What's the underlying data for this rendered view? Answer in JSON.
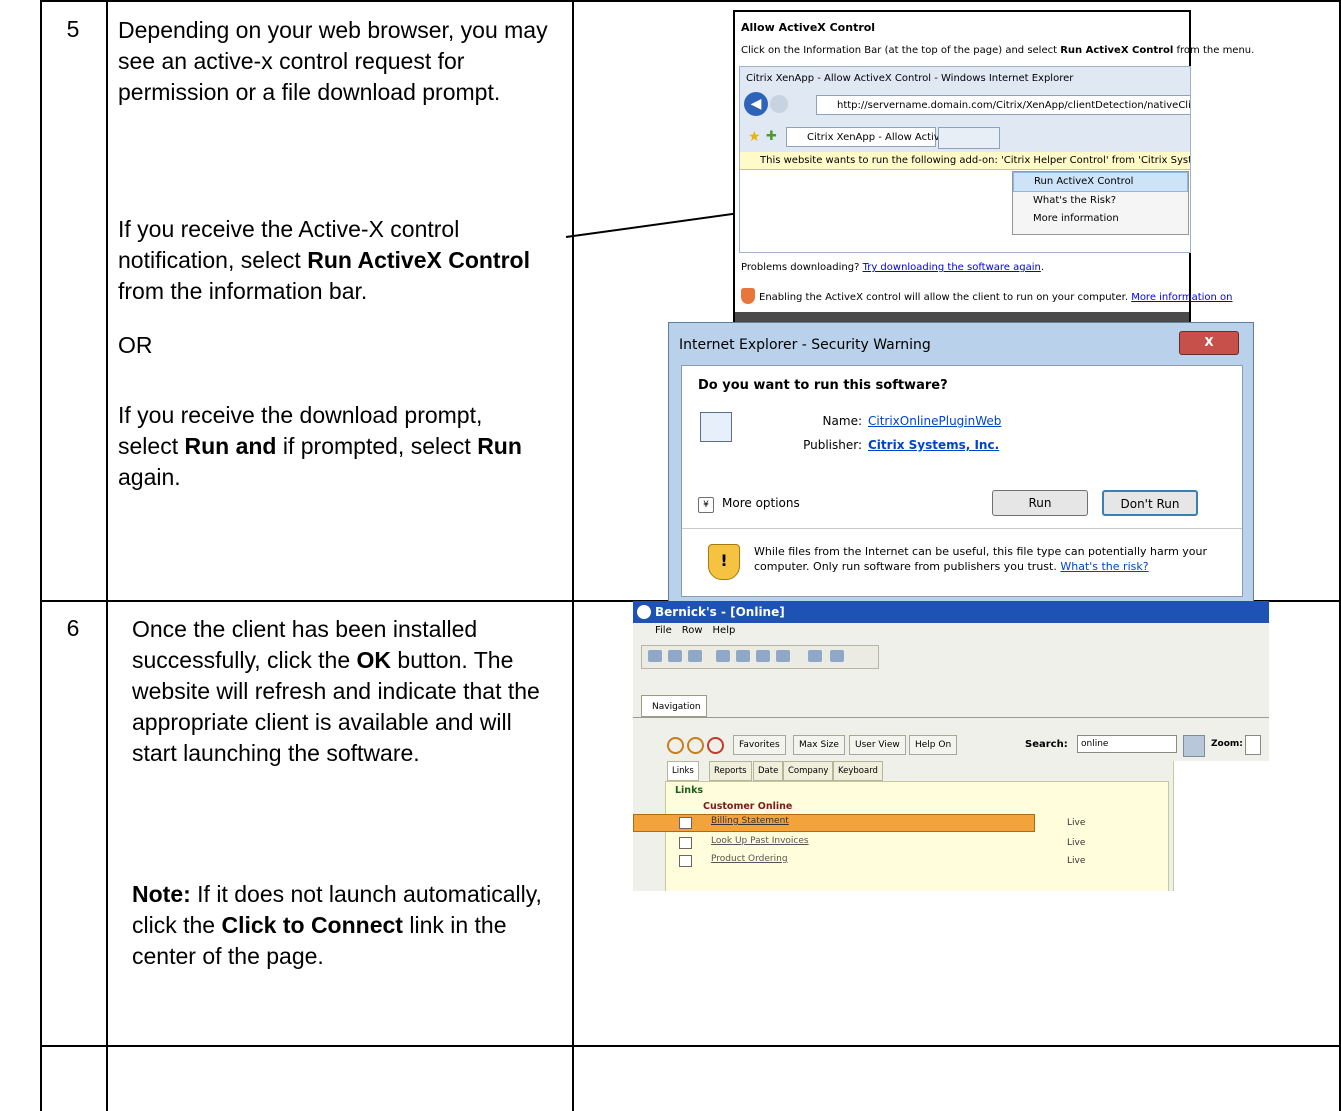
{
  "table": {
    "rows": [
      {
        "step": "5",
        "paragraphs": {
          "p1": "Depending on your web browser, you may see an active-x control request for permission or a file download prompt.",
          "p2_pre": "If you receive the Active-X control notification, select ",
          "p2_bold": "Run ActiveX Control",
          "p2_post": " from the information bar.",
          "p3": "OR",
          "p4_pre": "If you receive the download prompt, select ",
          "p4_bold1": "Run and",
          "p4_mid": " if prompted, select ",
          "p4_bold2": "Run",
          "p4_post": " again."
        }
      },
      {
        "step": "6",
        "paragraphs": {
          "p1_pre": "Once the client has been installed successfully, click the ",
          "p1_bold": "OK",
          "p1_post": " button.  The website will refresh and indicate that the appropriate client is available and will start launching the software.",
          "p2_bold": "Note:",
          "p2_mid": "  If it does not launch automatically, click the ",
          "p2_bold2": "Click to Connect",
          "p2_post": " link in the center of the page."
        }
      },
      {
        "step": ""
      }
    ]
  },
  "activex": {
    "heading": "Allow ActiveX Control",
    "instruction_pre": "Click on the Information Bar (at the top of the page) and select ",
    "instruction_bold": "Run ActiveX Control",
    "instruction_post": " from the menu.",
    "window_title": "Citrix XenApp - Allow ActiveX Control - Windows Internet Explorer",
    "url": "http://servername.domain.com/Citrix/XenApp/clientDetection/nativeClientD",
    "tab_title": "Citrix XenApp - Allow ActiveX Control",
    "infobar": "This website wants to run the following add-on: 'Citrix Helper Control' from 'Citrix Systems'.",
    "menu": [
      "Run ActiveX Control",
      "What's the Risk?",
      "More information"
    ],
    "problems_pre": "Problems downloading? ",
    "problems_link": "Try downloading the software again",
    "problems_post": ".",
    "enable_text": "Enabling the ActiveX control will allow the client to run on your computer. ",
    "enable_link": "More information on"
  },
  "security": {
    "title": "Internet Explorer - Security Warning",
    "close": "X",
    "question": "Do you want to run this software?",
    "name_label": "Name:",
    "name_value": "CitrixOnlinePluginWeb",
    "publisher_label": "Publisher:",
    "publisher_value": "Citrix Systems, Inc.",
    "more_options": "More options",
    "run": "Run",
    "dont_run": "Don't Run",
    "warning": "While files from the Internet can be useful, this file type can potentially harm your computer. Only run software from publishers you trust. ",
    "risk_link": "What's the risk?"
  },
  "app": {
    "title": "Bernick's - [Online]",
    "menu": [
      "File",
      "Row",
      "Help"
    ],
    "nav_tab": "Navigation",
    "buttons": [
      "Favorites",
      "Max Size",
      "User View",
      "Help On"
    ],
    "search_label": "Search:",
    "search_value": "online",
    "zoom_label": "Zoom:",
    "tabs": [
      "Links",
      "Reports",
      "Date",
      "Company",
      "Keyboard"
    ],
    "tree_root": "Links",
    "tree_group": "Customer Online",
    "items": [
      {
        "label": "Billing Statement",
        "status": "Live"
      },
      {
        "label": "Look Up Past Invoices",
        "status": "Live"
      },
      {
        "label": "Product Ordering",
        "status": "Live"
      }
    ]
  }
}
